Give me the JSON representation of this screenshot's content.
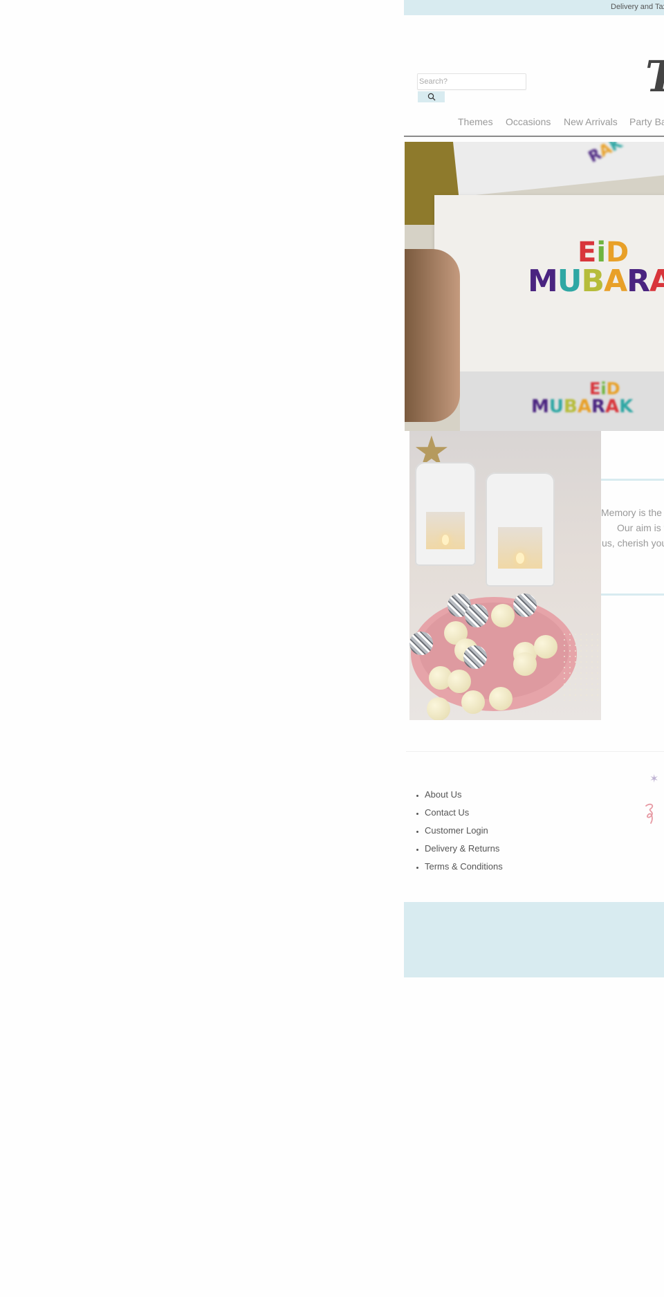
{
  "announcement": {
    "text": "Delivery and Tax"
  },
  "header": {
    "logo_text": "T",
    "search": {
      "placeholder": "Search?",
      "value": "",
      "button_icon": "search-icon"
    }
  },
  "nav": {
    "items": [
      {
        "label": "Themes"
      },
      {
        "label": "Occasions"
      },
      {
        "label": "New Arrivals"
      },
      {
        "label": "Party Ba"
      }
    ]
  },
  "hero": {
    "image_alt": "Eid Mubarak envelopes held in hand",
    "card_text_line1": "EiD",
    "card_text_line2": "MUBARAK",
    "blur_text_top": "RAK",
    "colors": {
      "e": "#d8353b",
      "i": "#6fb43f",
      "d": "#e8a028",
      "m": "#4a2480",
      "u": "#2fa7a4",
      "b": "#b6bc3a",
      "a": "#e8a028",
      "r": "#4a2480",
      "a2": "#d8353b",
      "k": "#2fa7a4"
    }
  },
  "feature_image": {
    "image_alt": "White lanterns with candles and pink moon-shaped tray of sweets and disco balls"
  },
  "quote": {
    "lines": [
      "Memory is the c",
      "Our aim is t",
      "us, cherish your"
    ]
  },
  "footer": {
    "links": [
      {
        "label": "About Us"
      },
      {
        "label": "Contact Us"
      },
      {
        "label": "Customer Login"
      },
      {
        "label": "Delivery & Returns"
      },
      {
        "label": "Terms & Conditions"
      }
    ],
    "decorations": [
      "star-icon",
      "swirl-icon"
    ]
  },
  "theme": {
    "accent": "#d8ebf0",
    "text": "#555555",
    "nav_text": "#999999",
    "logo": "#444444"
  }
}
